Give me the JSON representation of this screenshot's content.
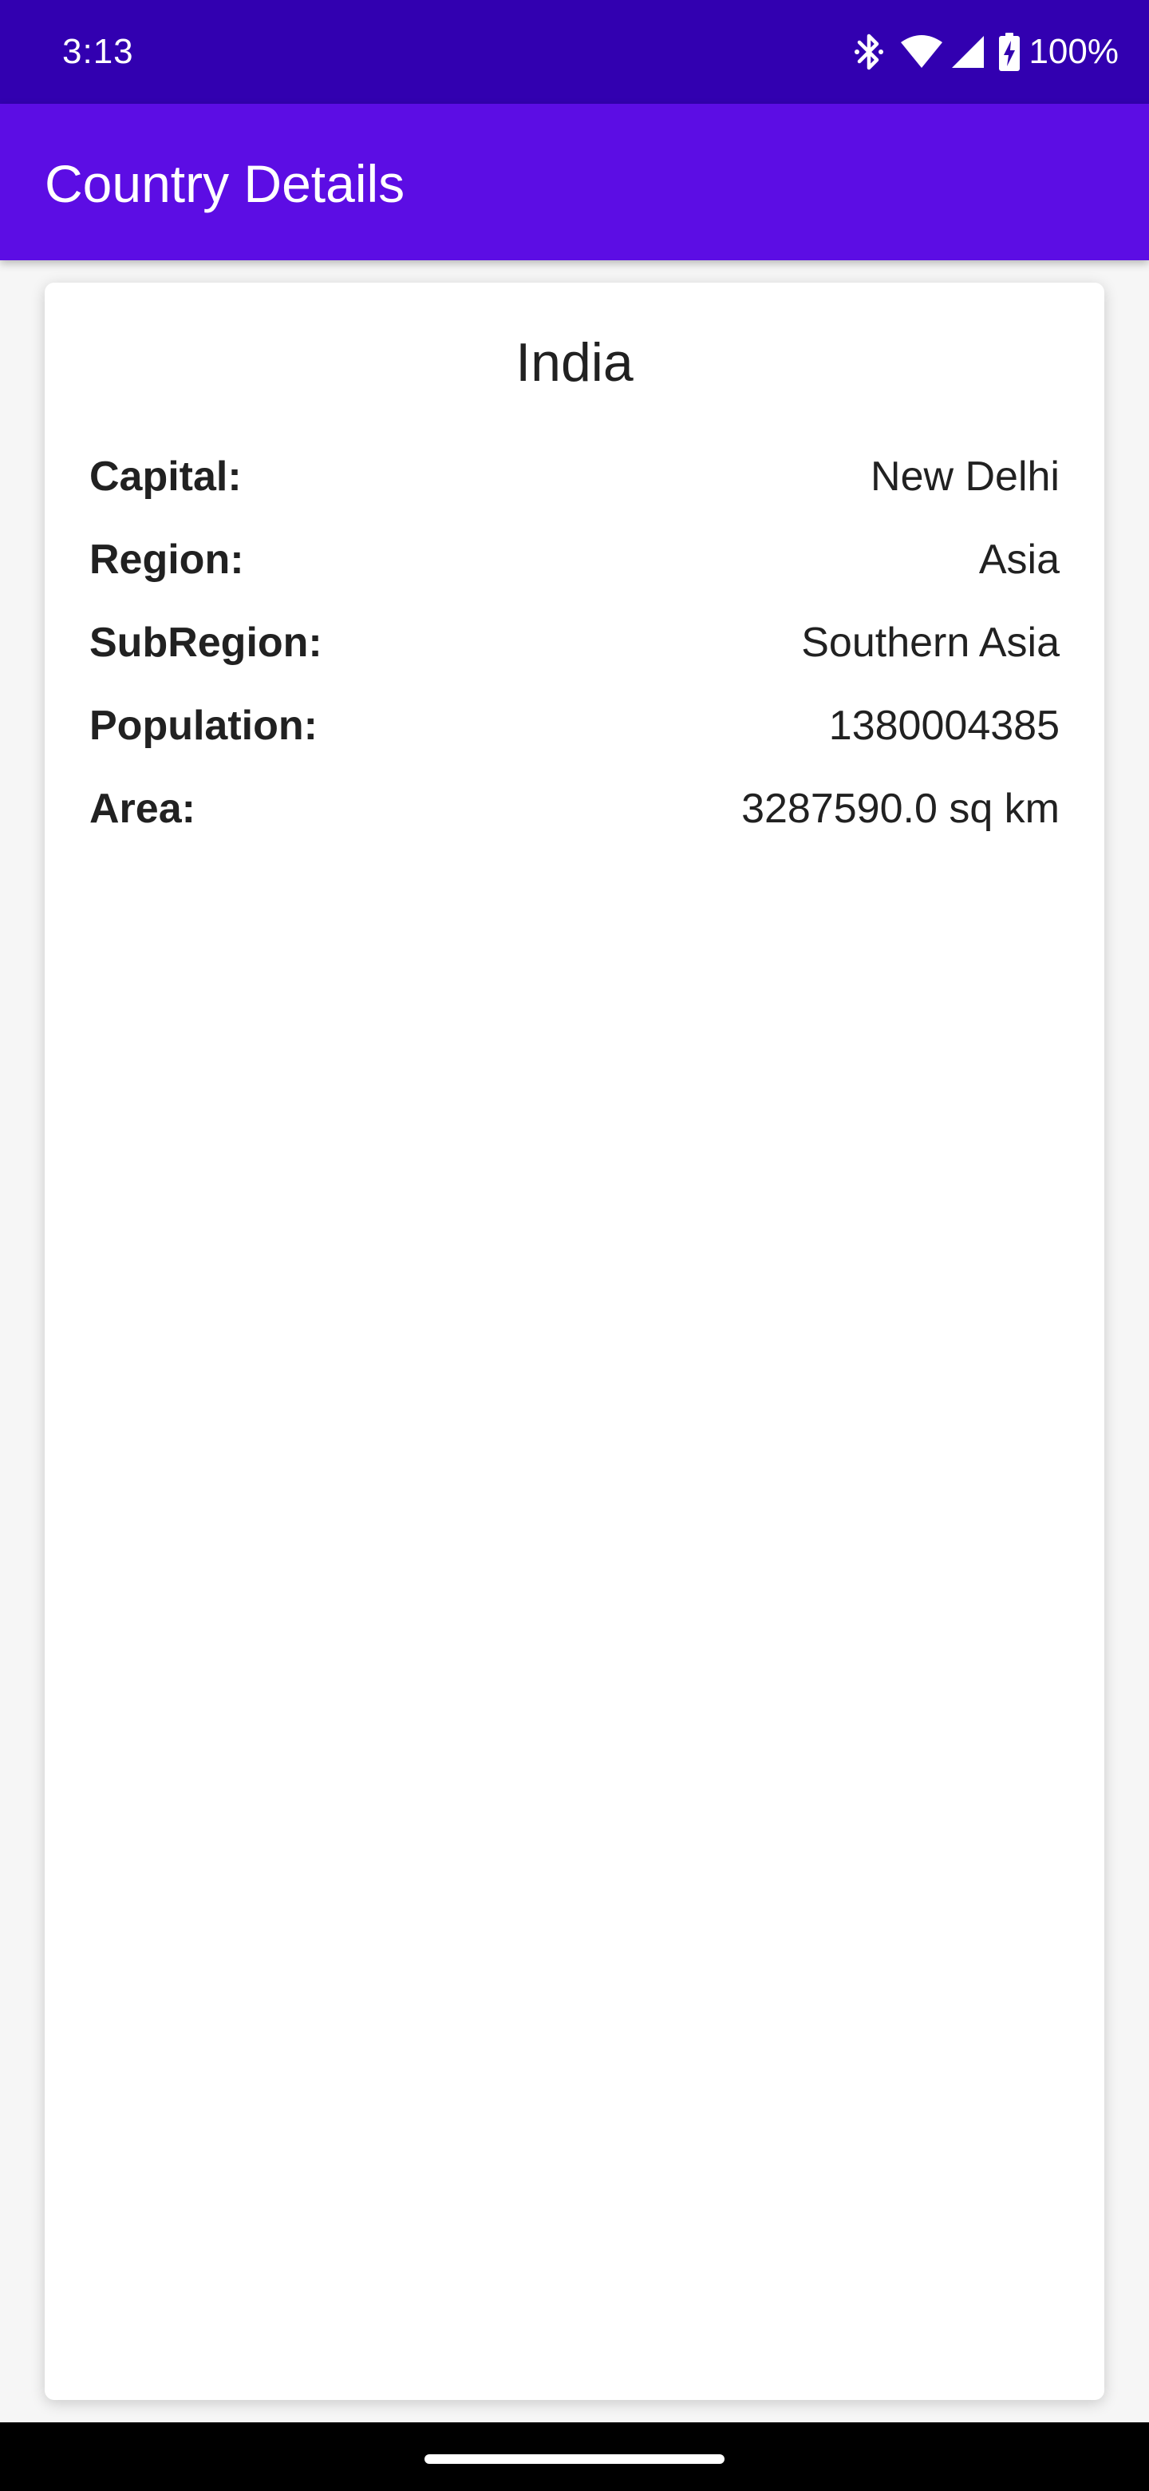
{
  "status_bar": {
    "time": "3:13",
    "battery_percent": "100%",
    "icons": [
      "bluetooth-icon",
      "wifi-icon",
      "cellular-signal-icon",
      "battery-charging-icon"
    ]
  },
  "app_bar": {
    "title": "Country Details"
  },
  "country": {
    "name": "India",
    "details": [
      {
        "label": "Capital:",
        "value": "New Delhi"
      },
      {
        "label": "Region:",
        "value": "Asia"
      },
      {
        "label": "SubRegion:",
        "value": "Southern Asia"
      },
      {
        "label": "Population:",
        "value": "1380004385"
      },
      {
        "label": "Area:",
        "value": "3287590.0 sq km"
      }
    ]
  },
  "colors": {
    "status_bar": "#3200b0",
    "app_bar": "#5c0de4",
    "text": "#212121",
    "background": "#f6f6f6"
  }
}
